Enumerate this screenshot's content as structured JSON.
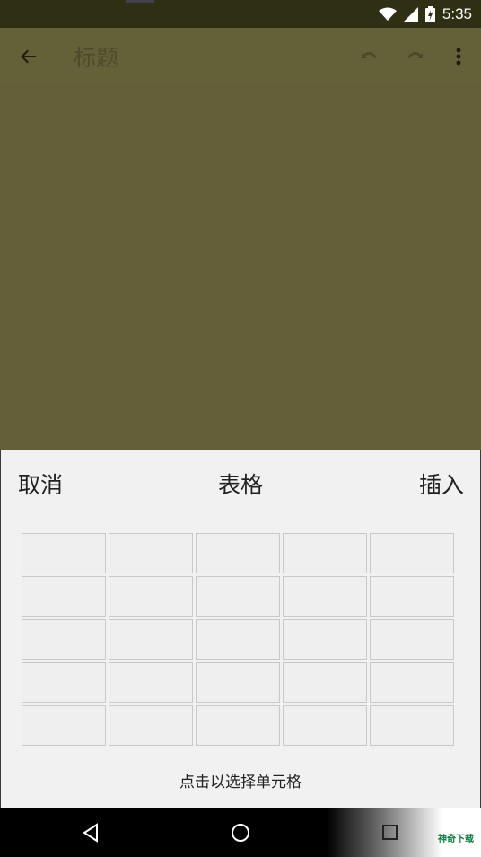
{
  "status_bar": {
    "time": "5:35"
  },
  "app_bar": {
    "title": "标题"
  },
  "sheet": {
    "cancel_label": "取消",
    "title": "表格",
    "insert_label": "插入",
    "hint": "点击以选择单元格",
    "grid": {
      "columns": 5,
      "visible_rows": 5
    }
  },
  "watermark": "神奇下载",
  "colors": {
    "app_bar": "#646037",
    "editor_background": "#645f38",
    "sheet_background": "#f1f1f1"
  }
}
